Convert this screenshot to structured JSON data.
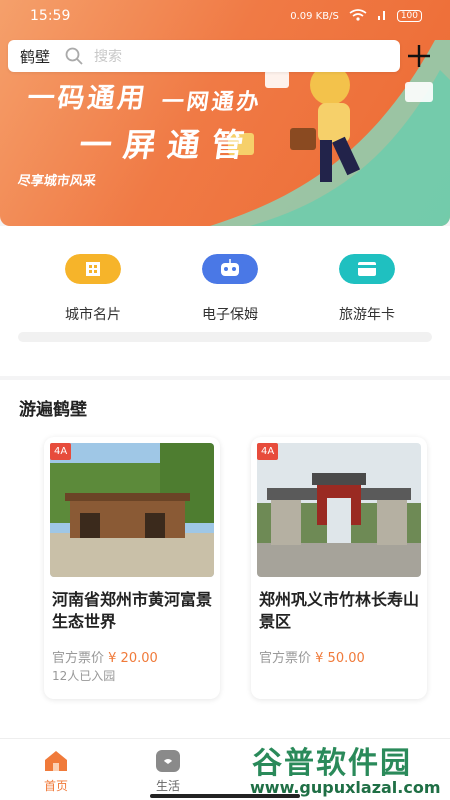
{
  "status": {
    "time": "15:59",
    "network_speed": "0.09",
    "speed_unit": "KB/S",
    "battery": "100"
  },
  "search": {
    "city": "鹤壁",
    "placeholder": "搜索"
  },
  "banner": {
    "line1a": "一码通用",
    "line1b": "一网通办",
    "line2": "一屏通管",
    "tag": "尽享城市风采"
  },
  "features": [
    {
      "label": "城市名片",
      "icon": "building-icon",
      "color": "#f6b42a"
    },
    {
      "label": "电子保姆",
      "icon": "robot-icon",
      "color": "#4a78e6"
    },
    {
      "label": "旅游年卡",
      "icon": "card-icon",
      "color": "#1fc0c0"
    }
  ],
  "section": {
    "title": "游遍鹤壁",
    "cards": [
      {
        "badge": "4A",
        "title": "河南省郑州市黄河富景生态世界",
        "price_label": "官方票价",
        "price": "¥ 20.00",
        "visitors": "12人已入园"
      },
      {
        "badge": "4A",
        "title": "郑州巩义市竹林长寿山景区",
        "price_label": "官方票价",
        "price": "¥ 50.00",
        "visitors": ""
      }
    ]
  },
  "nav": {
    "home": "首页",
    "life": "生活"
  },
  "watermark": {
    "title": "谷普软件园",
    "url": "www.gupuxlazal.com"
  },
  "colors": {
    "accent": "#f07a45",
    "nav_active": "#f07a3a"
  }
}
